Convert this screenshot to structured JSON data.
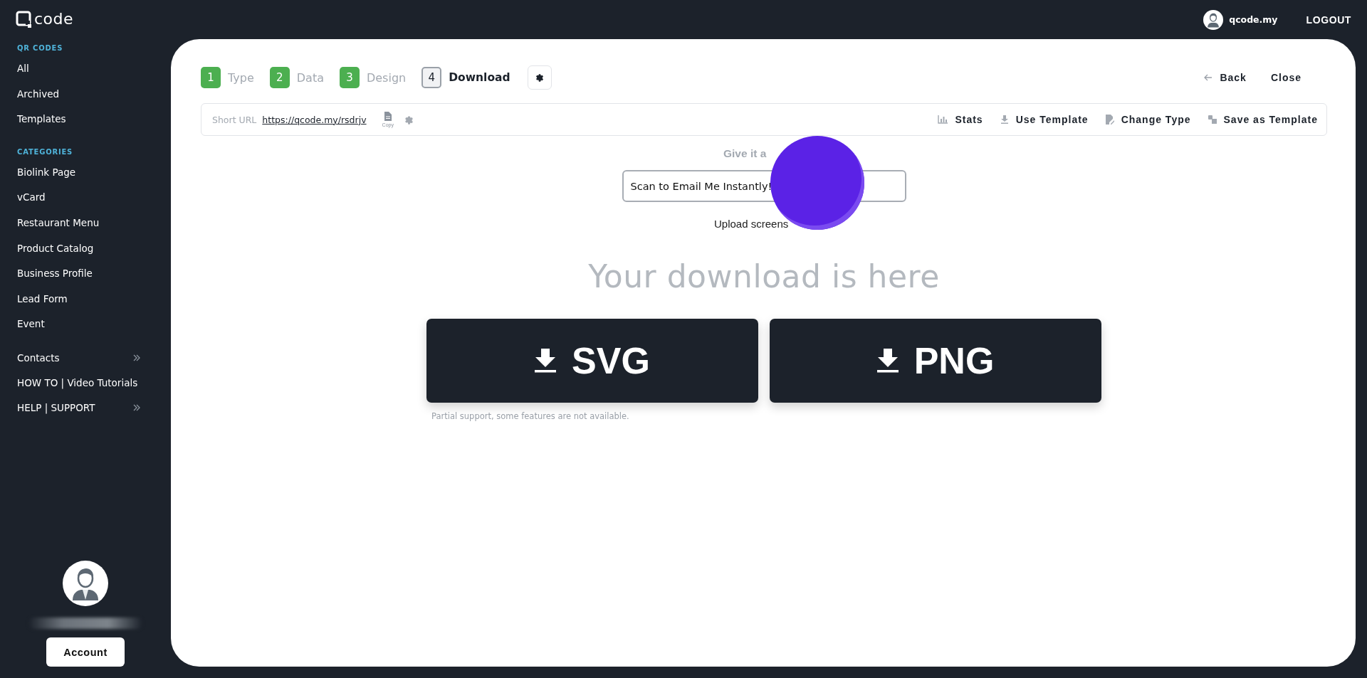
{
  "logo": {
    "text": "code"
  },
  "sidebar": {
    "sections": [
      {
        "heading": "QR CODES",
        "items": [
          {
            "label": "All"
          },
          {
            "label": "Archived"
          },
          {
            "label": "Templates"
          }
        ]
      },
      {
        "heading": "CATEGORIES",
        "items": [
          {
            "label": "Biolink Page"
          },
          {
            "label": "vCard"
          },
          {
            "label": "Restaurant Menu"
          },
          {
            "label": "Product Catalog"
          },
          {
            "label": "Business Profile"
          },
          {
            "label": "Lead Form"
          },
          {
            "label": "Event"
          }
        ]
      }
    ],
    "links": [
      {
        "label": "Contacts",
        "expandable": true
      },
      {
        "label": "HOW TO | Video Tutorials",
        "expandable": false
      },
      {
        "label": "HELP | SUPPORT",
        "expandable": true
      }
    ],
    "account_button": "Account"
  },
  "topbar": {
    "user": "qcode.my",
    "logout": "LOGOUT"
  },
  "steps": [
    {
      "number": "1",
      "label": "Type",
      "selected": false
    },
    {
      "number": "2",
      "label": "Data",
      "selected": false
    },
    {
      "number": "3",
      "label": "Design",
      "selected": false
    },
    {
      "number": "4",
      "label": "Download",
      "selected": true
    }
  ],
  "nav": {
    "back": "Back",
    "close": "Close"
  },
  "toolbar": {
    "short_url_label": "Short URL",
    "short_url": "https://qcode.my/rsdrjv",
    "copy": "Copy",
    "actions": [
      {
        "kind": "stats",
        "label": "Stats"
      },
      {
        "kind": "use",
        "label": "Use Template"
      },
      {
        "kind": "change",
        "label": "Change Type"
      },
      {
        "kind": "save",
        "label": "Save as Template"
      }
    ]
  },
  "name_label": "Give it a",
  "name_value": "Scan to Email Me Instantly!",
  "upload_text": "Upload screens",
  "heading": "Your download is here",
  "downloads": [
    {
      "label": "SVG"
    },
    {
      "label": "PNG"
    }
  ],
  "note": "Partial support, some features are not available."
}
